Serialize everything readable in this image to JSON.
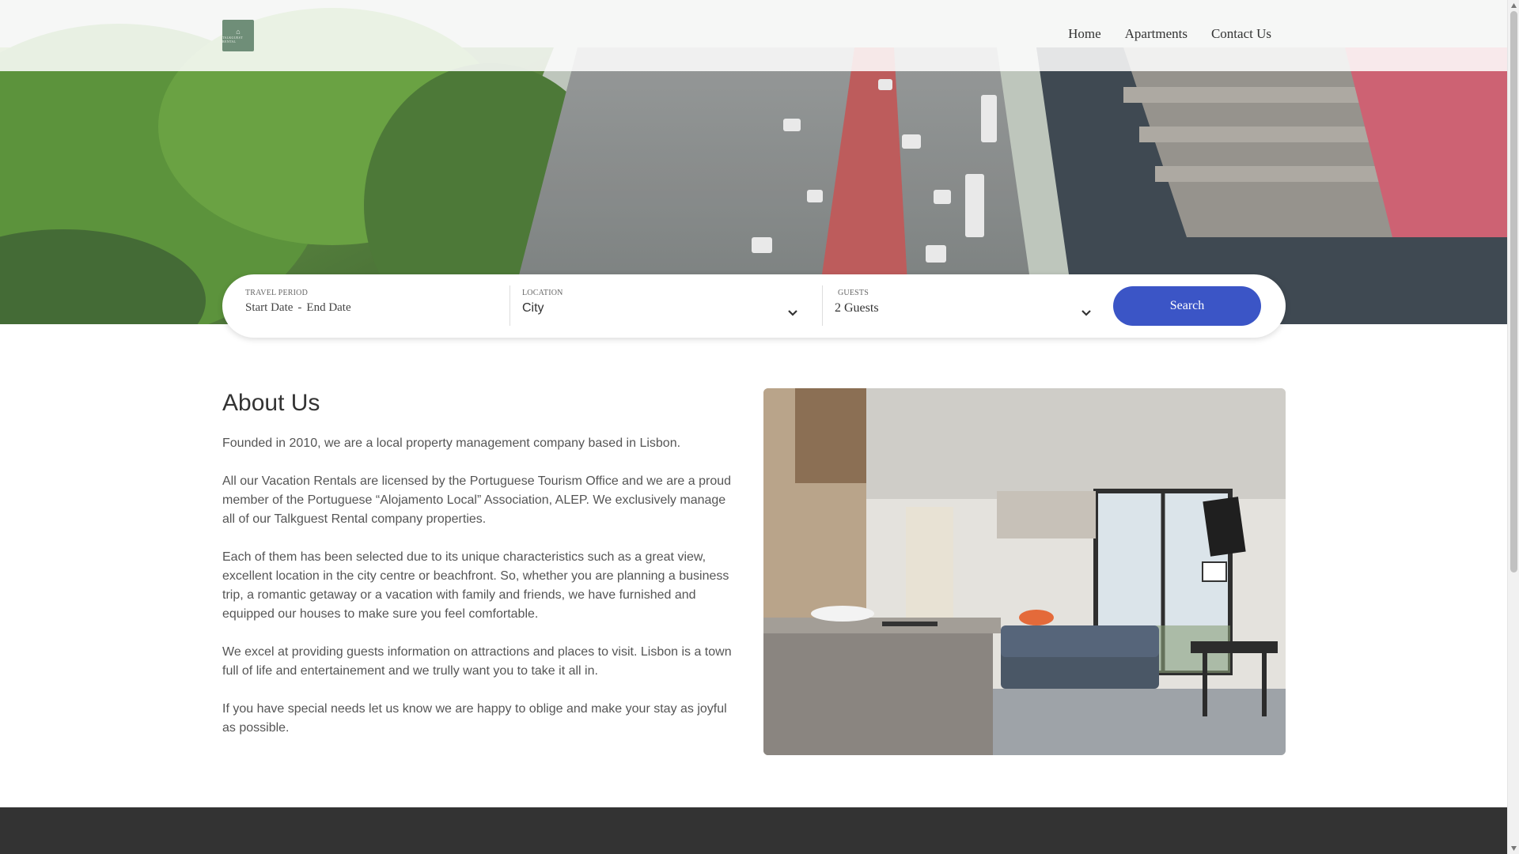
{
  "header": {
    "logo_mark": "⌂",
    "logo_text": "TALKGUEST RENTAL",
    "nav": [
      {
        "label": "Home"
      },
      {
        "label": "Apartments"
      },
      {
        "label": "Contact Us"
      }
    ]
  },
  "search": {
    "travel_label": "TRAVEL PERIOD",
    "start_placeholder": "Start Date",
    "separator": "-",
    "end_placeholder": "End Date",
    "location_label": "LOCATION",
    "location_value": "City",
    "guests_label": "GUESTS",
    "guests_value": "2 Guests",
    "button_label": "Search"
  },
  "about": {
    "title": "About Us",
    "paragraphs": [
      "Founded in 2010, we are a local property management company based in Lisbon.",
      "All our Vacation Rentals are licensed by the Portuguese Tourism Office and we are a proud member of the Portuguese “Alojamento Local” Association, ALEP. We exclusively manage all of our Talkguest Rental company properties.",
      "Each of them has been selected due to its unique characteristics such as a great view, excellent location in the city centre or beachfront. So, whether you are planning a business trip, a romantic getaway or a vacation with family and friends, we have furnished and equipped our houses to make sure you feel comfortable.",
      "We excel at providing guests information on attractions and places to visit. Lisbon is a town full of life and entertainement and we trully want you to take it all in.",
      "If you have special needs let us know we are happy to oblige and make your stay as joyful as possible."
    ]
  },
  "colors": {
    "primary": "#3b55c6",
    "footer": "#333333",
    "logo": "#6f8e78"
  }
}
